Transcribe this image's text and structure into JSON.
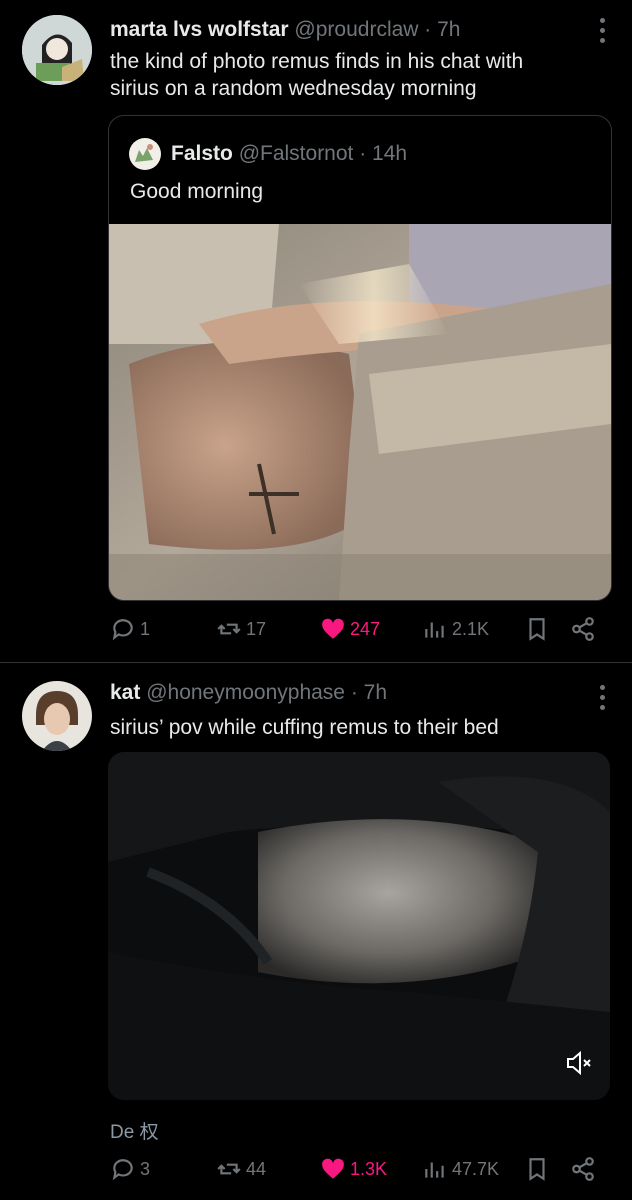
{
  "posts": [
    {
      "author_name": "marta lvs wolfstar",
      "author_meta": "@proudrclaw · 7h",
      "text_line1": "the kind of photo remus finds in his chat with",
      "text_line2": "sirius on a random wednesday morning",
      "quote": {
        "author_name": "Falsto",
        "author_meta": "@Falstornot · 14h",
        "text": "Good morning"
      },
      "actions": {
        "replies": "1",
        "reposts": "17",
        "likes": "247",
        "views": "2.1K"
      }
    },
    {
      "author_name": "kat",
      "author_meta": "@honeymoonyphase · 7h",
      "text": "sirius’ pov while cuffing remus to their bed",
      "translate_label": "De 权",
      "actions": {
        "replies": "3",
        "reposts": "44",
        "likes": "1.3K",
        "views": "47.7K"
      }
    }
  ],
  "colors": {
    "background": "#000000",
    "text": "#e7e9ea",
    "muted": "#71767b",
    "like": "#f91880",
    "divider": "#2f3336"
  },
  "icons": [
    "reply-icon",
    "repost-icon",
    "like-icon",
    "views-icon",
    "bookmark-icon",
    "share-icon",
    "more-icon",
    "mute-icon"
  ]
}
